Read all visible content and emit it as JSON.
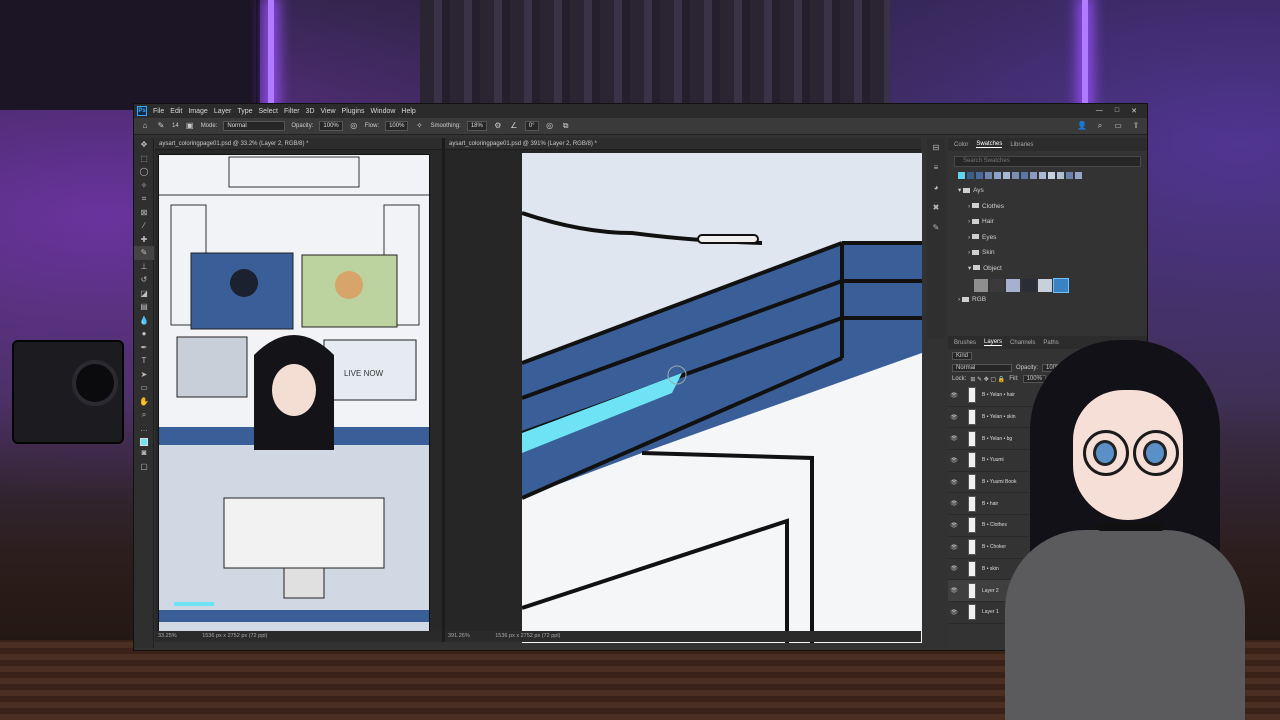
{
  "app": {
    "logo": "Ps",
    "menu": [
      "File",
      "Edit",
      "Image",
      "Layer",
      "Type",
      "Select",
      "Filter",
      "3D",
      "View",
      "Plugins",
      "Window",
      "Help"
    ],
    "window_controls": [
      "—",
      "□",
      "✕"
    ]
  },
  "options": {
    "brush_size": "14",
    "mode_label": "Mode:",
    "mode_value": "Normal",
    "opacity_label": "Opacity:",
    "opacity_value": "100%",
    "flow_label": "Flow:",
    "flow_value": "100%",
    "smoothing_label": "Smoothing:",
    "smoothing_value": "18%",
    "angle_value": "0°"
  },
  "doc1": {
    "tab": "aysart_coloringpage01.psd @ 33.2% (Layer 2, RGB/8) *",
    "zoom": "33.25%",
    "dims": "1536 px x 2752 px (72 ppi)",
    "sign_text": "LIVE NOW"
  },
  "doc2": {
    "tab": "aysart_coloringpage01.psd @ 391% (Layer 2, RGB/8) *",
    "zoom": "391.26%",
    "dims": "1536 px x 2752 px (72 ppi)"
  },
  "swatches_panel": {
    "tabs": [
      "Color",
      "Swatches",
      "Libraries"
    ],
    "active_tab": "Swatches",
    "search_placeholder": "Search Swatches",
    "top_colors": [
      "#5fd4ec",
      "#3b5d8a",
      "#4a6a9a",
      "#6f86b0",
      "#8ea3c8",
      "#a9b7d6",
      "#7b8fb5",
      "#5c76a6",
      "#8c9bbd",
      "#aab8d2",
      "#c5d0e4",
      "#b2bfd9",
      "#6e80a8",
      "#94a5c6"
    ],
    "groups": [
      {
        "label": "Ays",
        "open": true
      },
      {
        "label": "Clothes",
        "open": false
      },
      {
        "label": "Hair",
        "open": false
      },
      {
        "label": "Eyes",
        "open": false
      },
      {
        "label": "Skin",
        "open": false
      },
      {
        "label": "Object",
        "open": true
      }
    ],
    "object_colors": [
      "#8e8e8e",
      "#3a3a3c",
      "#a6b0d0",
      "#2a2d36",
      "#c8d0dc",
      "#3b82c4"
    ],
    "bottom_group": "RGB"
  },
  "layers_panel": {
    "tabs": [
      "Brushes",
      "Layers",
      "Channels",
      "Paths"
    ],
    "active_tab": "Layers",
    "filter": "Kind",
    "blend_mode": "Normal",
    "opacity_label": "Opacity:",
    "opacity_value": "100%",
    "lock_label": "Lock:",
    "fill_label": "Fill:",
    "fill_value": "100%",
    "layers": [
      {
        "name": "B • Yelan • hair",
        "selected": false
      },
      {
        "name": "B • Yelan • skin",
        "selected": false
      },
      {
        "name": "B • Yelan • bg",
        "selected": false
      },
      {
        "name": "B • Yuumi",
        "selected": false
      },
      {
        "name": "B • Yuumi Book",
        "selected": false
      },
      {
        "name": "B • hair",
        "selected": false
      },
      {
        "name": "B • Clothes",
        "selected": false
      },
      {
        "name": "B • Choker",
        "selected": false
      },
      {
        "name": "B • skin",
        "selected": false
      },
      {
        "name": "Layer 2",
        "selected": true
      },
      {
        "name": "Layer 1",
        "selected": false
      }
    ]
  },
  "colors": {
    "accent_cyan": "#6ee3f5",
    "desk_blue": "#3a5f98",
    "ps_blue": "#31a8ff"
  }
}
